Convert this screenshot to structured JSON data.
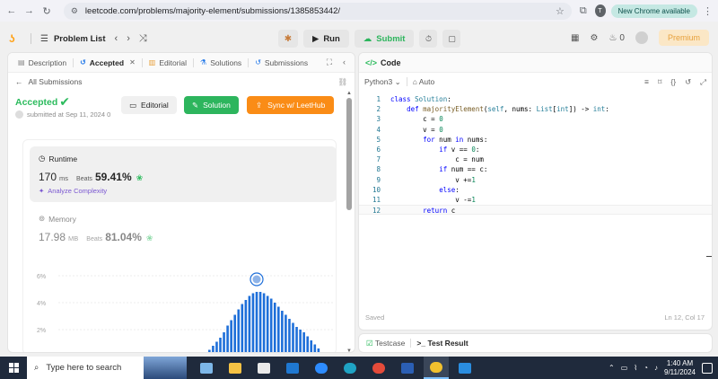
{
  "browser": {
    "url": "leetcode.com/problems/majority-element/submissions/1385853442/",
    "profile_initial": "T",
    "update_label": "New Chrome available"
  },
  "nav": {
    "problem_list": "Problem List",
    "run": "Run",
    "submit": "Submit",
    "streak_count": "0",
    "premium": "Premium"
  },
  "left_tabs": [
    "Description",
    "Accepted",
    "Editorial",
    "Solutions",
    "Submissions"
  ],
  "submission": {
    "back_label": "All Submissions",
    "status": "Accepted",
    "submitted_at": "submitted at Sep 11, 2024 0",
    "editorial_btn": "Editorial",
    "solution_btn": "Solution",
    "sync_btn": "Sync w/ LeetHub",
    "runtime": {
      "title": "Runtime",
      "value": "170",
      "unit": "ms",
      "beats_label": "Beats",
      "beats": "59.41%",
      "analyze": "Analyze Complexity"
    },
    "memory": {
      "title": "Memory",
      "value": "17.98",
      "unit": "MB",
      "beats_label": "Beats",
      "beats": "81.04%"
    }
  },
  "chart_data": {
    "type": "bar",
    "title": "",
    "ylabel": "",
    "yticks": [
      "6%",
      "4%",
      "2%"
    ],
    "ylim": [
      0,
      6.8
    ],
    "values": [
      0.3,
      0.5,
      0.8,
      1.1,
      1.4,
      1.8,
      2.3,
      2.7,
      3.1,
      3.5,
      3.9,
      4.2,
      4.5,
      4.7,
      4.8,
      4.8,
      4.7,
      4.5,
      4.3,
      4.0,
      3.7,
      3.4,
      3.1,
      2.8,
      2.5,
      2.2,
      2.0,
      1.8,
      1.5,
      1.2,
      0.9,
      0.6
    ],
    "highlight_index": 14,
    "bar_color": "#1e6fd9"
  },
  "editor": {
    "title": "Code",
    "language": "Python3",
    "mode": "Auto",
    "lines": [
      "class Solution:",
      "    def majorityElement(self, nums: List[int]) -> int:",
      "        c = 0",
      "        v = 0",
      "        for num in nums:",
      "            if v == 0:",
      "                c = num",
      "            if num == c:",
      "                v +=1",
      "            else:",
      "                v -=1",
      "        return c"
    ],
    "saved": "Saved",
    "position": "Ln 12, Col 17"
  },
  "console": {
    "testcase": "Testcase",
    "result": "Test Result"
  },
  "taskbar": {
    "search_placeholder": "Type here to search",
    "time": "1:40 AM",
    "date": "9/11/2024"
  }
}
